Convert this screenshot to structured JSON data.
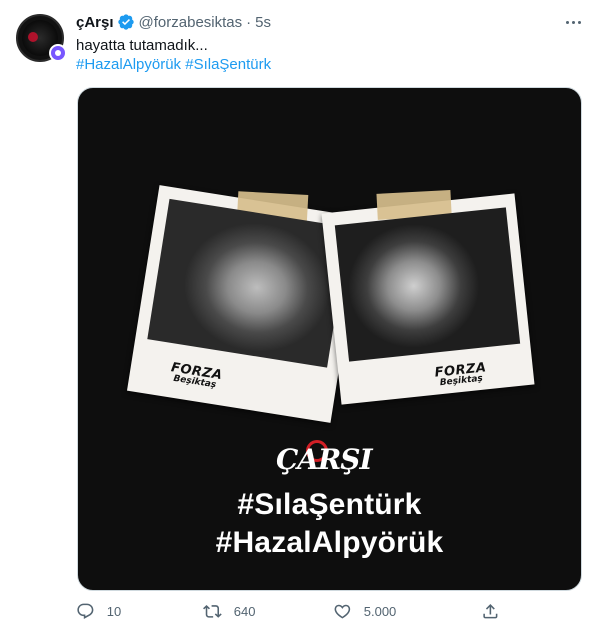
{
  "tweet": {
    "author_name": "çArşı",
    "handle": "@forzabesiktas",
    "separator": "·",
    "time": "5s",
    "text": "hayatta tutamadık...",
    "hashtags": [
      "#HazalAlpyörük",
      "#SılaŞentürk"
    ]
  },
  "media": {
    "image_text": {
      "logo": "ÇARŞI",
      "line1": "#SılaŞentürk",
      "line2": "#HazalAlpyörük",
      "polaroid_brand_top": "FORZA",
      "polaroid_brand_bottom": "Beşiktaş"
    }
  },
  "actions": {
    "reply_count": "10",
    "retweet_count": "640",
    "like_count": "5.000"
  },
  "colors": {
    "link": "#1d9bf0",
    "secondary_text": "#536471",
    "verified": "#1d9bf0",
    "accent_red": "#d21f26"
  },
  "icons": [
    "verified-icon",
    "more-icon",
    "reply-icon",
    "retweet-icon",
    "like-icon",
    "share-icon"
  ]
}
